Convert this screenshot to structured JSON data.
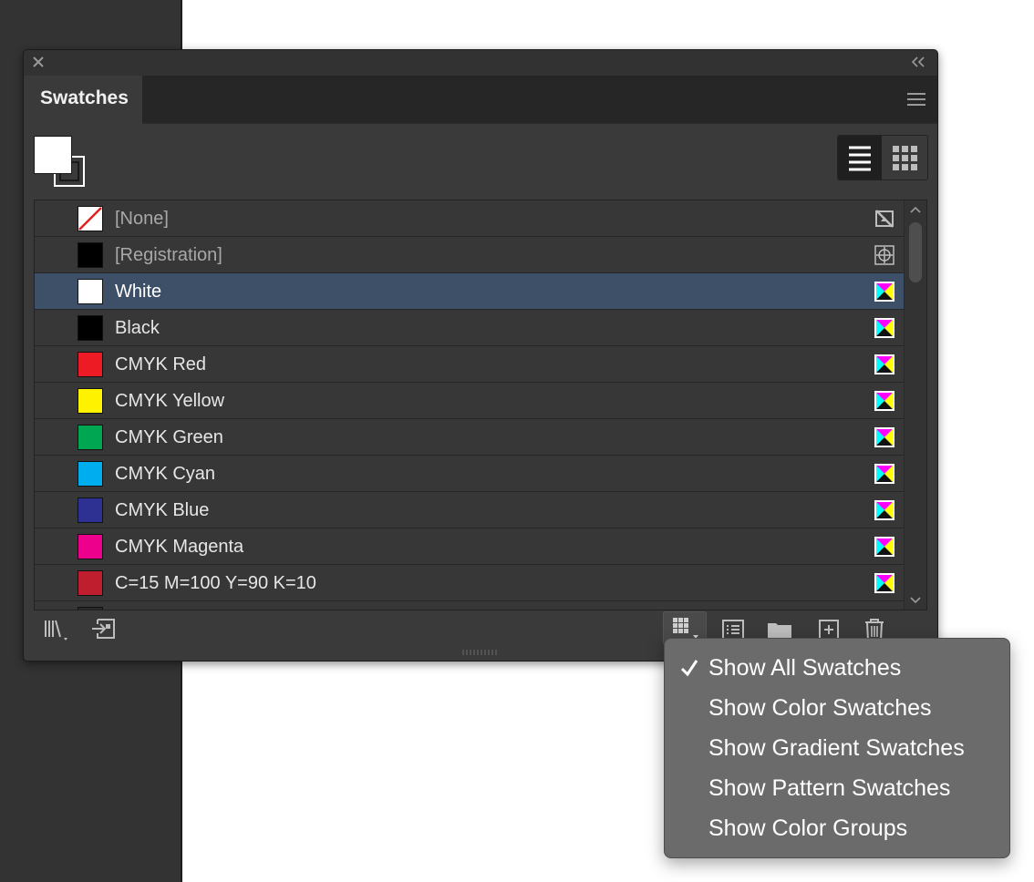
{
  "panel": {
    "tab_label": "Swatches",
    "swatches": [
      {
        "label": "[None]",
        "color": "none",
        "type_icon": "none-not-editable-icon",
        "dim": true
      },
      {
        "label": "[Registration]",
        "color": "#000000",
        "type_icon": "registration-icon",
        "dim": true
      },
      {
        "label": "White",
        "color": "#ffffff",
        "type_icon": "cmyk-process-icon",
        "selected": true
      },
      {
        "label": "Black",
        "color": "#000000",
        "type_icon": "cmyk-process-icon"
      },
      {
        "label": "CMYK Red",
        "color": "#ed1c24",
        "type_icon": "cmyk-process-icon"
      },
      {
        "label": "CMYK Yellow",
        "color": "#fff200",
        "type_icon": "cmyk-process-icon"
      },
      {
        "label": "CMYK Green",
        "color": "#00a651",
        "type_icon": "cmyk-process-icon"
      },
      {
        "label": "CMYK Cyan",
        "color": "#00aeef",
        "type_icon": "cmyk-process-icon"
      },
      {
        "label": "CMYK Blue",
        "color": "#2e3192",
        "type_icon": "cmyk-process-icon"
      },
      {
        "label": "CMYK Magenta",
        "color": "#ec008c",
        "type_icon": "cmyk-process-icon"
      },
      {
        "label": "C=15 M=100 Y=90 K=10",
        "color": "#be1e2d",
        "type_icon": "cmyk-process-icon"
      }
    ],
    "bottom_icons": [
      "swatch-libraries-icon",
      "place-swatches-icon",
      "show-swatch-kinds-icon",
      "swatch-options-icon",
      "new-color-group-icon",
      "new-swatch-icon",
      "delete-swatch-icon"
    ],
    "fill_color": "#ffffff",
    "selected_row_color": "#3d5068"
  },
  "popup_menu": {
    "items": [
      {
        "label": "Show All Swatches",
        "checked": true
      },
      {
        "label": "Show Color Swatches",
        "checked": false
      },
      {
        "label": "Show Gradient Swatches",
        "checked": false
      },
      {
        "label": "Show Pattern Swatches",
        "checked": false
      },
      {
        "label": "Show Color Groups",
        "checked": false
      }
    ]
  }
}
